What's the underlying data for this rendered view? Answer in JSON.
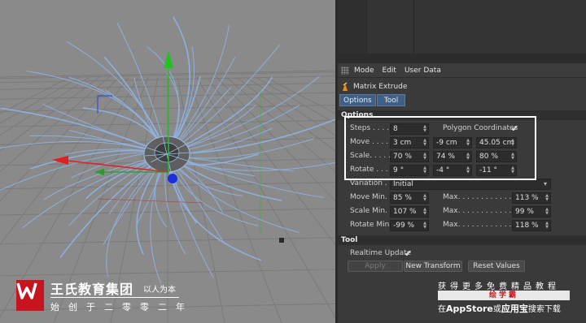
{
  "menubar": {
    "items": [
      "Mode",
      "Edit",
      "User Data"
    ]
  },
  "object": {
    "name": "Matrix Extrude"
  },
  "tabs": [
    "Options",
    "Tool"
  ],
  "options": {
    "section_label": "Options",
    "steps": {
      "label": "Steps . . . . .",
      "value": "8"
    },
    "polygon_coordinates": {
      "label": "Polygon Coordinates",
      "checked": "✔"
    },
    "move": {
      "label": "Move . . . . .",
      "values": [
        "3 cm",
        "-9 cm",
        "45.05 cm"
      ]
    },
    "scale": {
      "label": "Scale. . . . .",
      "values": [
        "70 %",
        "74 %",
        "80 %"
      ]
    },
    "rotate": {
      "label": "Rotate . . . .",
      "values": [
        "9 °",
        "-4 °",
        "-11 °"
      ]
    },
    "variation": {
      "label": "Variation . . .",
      "value": "Initial"
    },
    "move_min": {
      "label": "Move Min.",
      "value": "85 %",
      "max_label": "Max. . . . . . . . . . . . . .",
      "max_value": "113 %"
    },
    "scale_min": {
      "label": "Scale Min.",
      "value": "107 %",
      "max_label": "Max. . . . . . . . . . . . . .",
      "max_value": "99 %"
    },
    "rotate_min": {
      "label": "Rotate Min.",
      "value": "-99 %",
      "max_label": "Max. . . . . . . . . . . . . .",
      "max_value": "118 %"
    }
  },
  "tool": {
    "section_label": "Tool",
    "realtime_update": {
      "label": "Realtime Update",
      "checked": "✔"
    },
    "apply_label": "Apply",
    "new_transform_label": "New Transform",
    "reset_values_label": "Reset Values"
  },
  "watermark": {
    "logo_letter": "W",
    "title": "王氏教育集团",
    "slogan": "以人为本",
    "subtitle": "始创于二零零二年"
  },
  "promo": {
    "line1": "获得更多免费精品教程",
    "line2": "绘学霸",
    "line3_prefix": "在",
    "line3_appstore": "AppStore",
    "line3_mid": "或",
    "line3_app": "应用宝",
    "line3_suffix": "搜索下载"
  },
  "colors": {
    "accent_tab": "#3f5f86",
    "viewport_bg": "#8a8a8a",
    "mesh_stroke": "#8fb4e6",
    "axis_x": "#e02020",
    "axis_y": "#20c020",
    "axis_z": "#2040e0",
    "brand_red": "#c8141e"
  }
}
